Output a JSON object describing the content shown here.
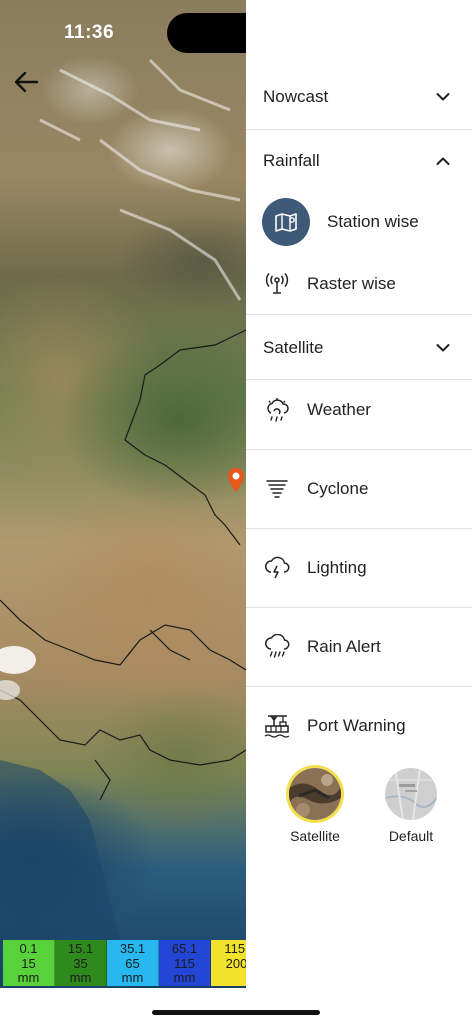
{
  "status_bar": {
    "time": "11:36"
  },
  "map": {
    "legend": [
      {
        "lines": [
          "0.1",
          "15",
          "mm"
        ],
        "color": "#58d13b"
      },
      {
        "lines": [
          "15.1",
          "35",
          "mm"
        ],
        "color": "#2f8a1e"
      },
      {
        "lines": [
          "35.1",
          "65",
          "mm"
        ],
        "color": "#27b8f0"
      },
      {
        "lines": [
          "65.1",
          "115",
          "mm"
        ],
        "color": "#2446d6"
      },
      {
        "lines": [
          "115.",
          "200",
          ""
        ],
        "color": "#f2e22b"
      }
    ],
    "marker_color": "#e8571c"
  },
  "drawer": {
    "sections": {
      "nowcast": "Nowcast",
      "rainfall": "Rainfall",
      "satellite": "Satellite"
    },
    "rainfall_items": {
      "station_wise": "Station wise",
      "raster_wise": "Raster wise"
    },
    "items": {
      "weather": "Weather",
      "cyclone": "Cyclone",
      "lighting": "Lighting",
      "rain_alert": "Rain Alert",
      "port_warning": "Port Warning"
    },
    "basemaps": {
      "satellite": "Satellite",
      "default": "Default"
    },
    "accent_color": "#3e5a77",
    "selected_ring_color": "#f4e04d"
  }
}
